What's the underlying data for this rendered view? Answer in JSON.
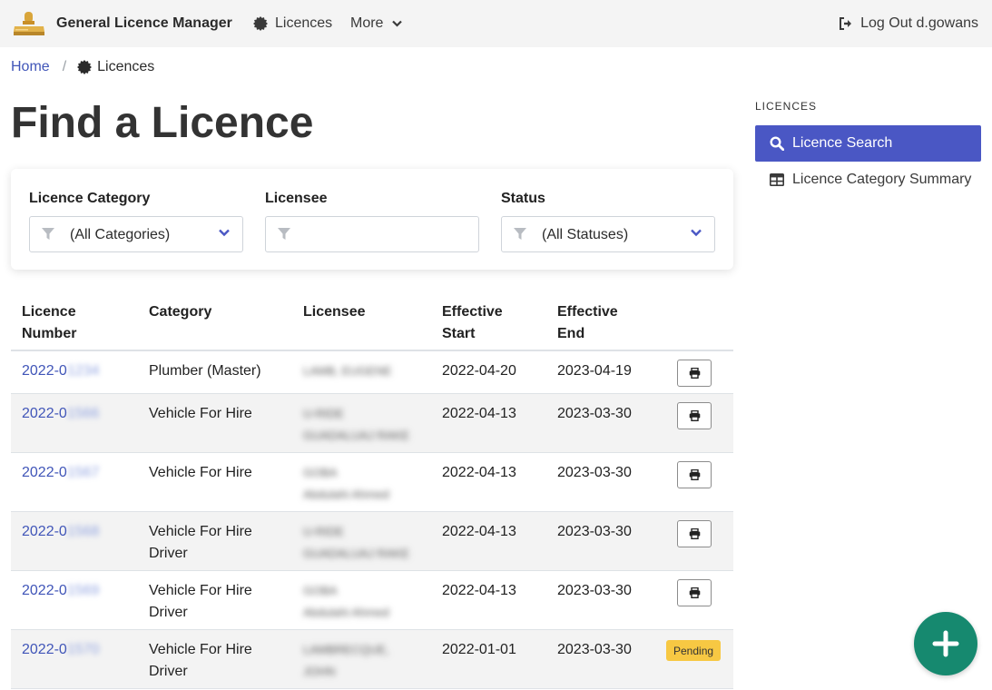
{
  "navbar": {
    "brand_name": "General Licence Manager",
    "licences_label": "Licences",
    "more_label": "More",
    "logout_label": "Log Out d.gowans"
  },
  "breadcrumb": {
    "home": "Home",
    "separator": "/",
    "current": "Licences"
  },
  "page_title": "Find a Licence",
  "filters": {
    "category": {
      "label": "Licence Category",
      "value": "(All Categories)"
    },
    "licensee": {
      "label": "Licensee",
      "value": ""
    },
    "status": {
      "label": "Status",
      "value": "(All Statuses)"
    }
  },
  "table": {
    "headers": {
      "number_1": "Licence",
      "number_2": "Number",
      "category": "Category",
      "licensee": "Licensee",
      "start_1": "Effective",
      "start_2": "Start",
      "end_1": "Effective",
      "end_2": "End"
    },
    "rows": [
      {
        "number_prefix": "2022-0",
        "number_hidden": "1234",
        "category_1": "Plumber (Master)",
        "category_2": "",
        "licensee_1": "LAMB, EUGENE",
        "licensee_2": "",
        "start": "2022-04-20",
        "end": "2023-04-19",
        "action": "print"
      },
      {
        "number_prefix": "2022-0",
        "number_hidden": "1566",
        "category_1": "Vehicle For Hire",
        "category_2": "",
        "licensee_1": "U-RIDE",
        "licensee_2": "GUADALUAJ RAKE",
        "start": "2022-04-13",
        "end": "2023-03-30",
        "action": "print"
      },
      {
        "number_prefix": "2022-0",
        "number_hidden": "1567",
        "category_1": "Vehicle For Hire",
        "category_2": "",
        "licensee_1": "GOBA",
        "licensee_2": "Abdulahi Ahmed",
        "start": "2022-04-13",
        "end": "2023-03-30",
        "action": "print"
      },
      {
        "number_prefix": "2022-0",
        "number_hidden": "1568",
        "category_1": "Vehicle For Hire",
        "category_2": "Driver",
        "licensee_1": "U-RIDE",
        "licensee_2": "GUADALUAJ RAKE",
        "start": "2022-04-13",
        "end": "2023-03-30",
        "action": "print"
      },
      {
        "number_prefix": "2022-0",
        "number_hidden": "1569",
        "category_1": "Vehicle For Hire",
        "category_2": "Driver",
        "licensee_1": "GOBA",
        "licensee_2": "Abdulahi Ahmed",
        "start": "2022-04-13",
        "end": "2023-03-30",
        "action": "print"
      },
      {
        "number_prefix": "2022-0",
        "number_hidden": "1570",
        "category_1": "Vehicle For Hire",
        "category_2": "Driver",
        "licensee_1": "LAMBRECQUE,",
        "licensee_2": "JOHN",
        "start": "2022-01-01",
        "end": "2023-03-30",
        "action": "badge",
        "badge": "Pending"
      }
    ]
  },
  "sidebar": {
    "title": "LICENCES",
    "items": [
      {
        "label": "Licence Search",
        "icon": "search-icon",
        "active": true
      },
      {
        "label": "Licence Category Summary",
        "icon": "table-icon",
        "active": false
      }
    ]
  },
  "colors": {
    "accent": "#4a57c4",
    "link": "#4055b8",
    "fab": "#16896f",
    "badge": "#f7c843"
  }
}
